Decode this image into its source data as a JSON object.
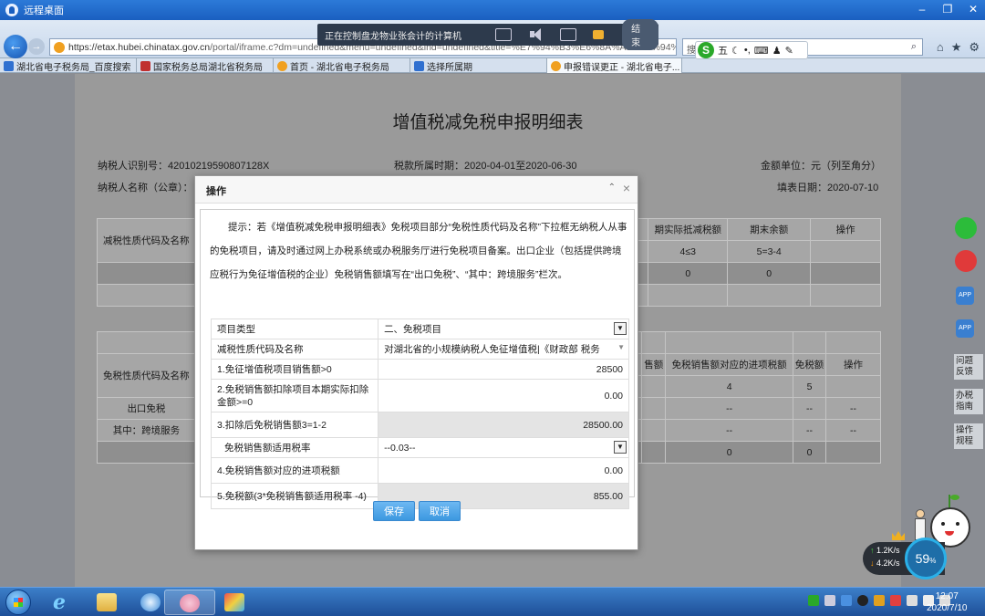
{
  "remote_desktop": {
    "title": "远程桌面",
    "toolbar_status": "正在控制盘龙物业张会计的计算机",
    "end_button": "结束"
  },
  "browser": {
    "url_host": "https://etax.hubei.chinatax.gov.cn",
    "url_path": "/portal/iframe.c?dm=undefined&menu=undefined&ind=undefined&title=%E7%94%B3%E6%8A%A5%E9%94%99%E8%AF%AF%E6%9B%B4%E6%AD%A3",
    "search_placeholder": "搜",
    "ime_label": "五",
    "tabs": [
      {
        "label": "湖北省电子税务局_百度搜索",
        "icon_color": "#3070d0"
      },
      {
        "label": "国家税务总局湖北省税务局",
        "icon_color": "#c03030"
      },
      {
        "label": "首页 - 湖北省电子税务局",
        "icon_color": "#f0a020"
      },
      {
        "label": "选择所属期",
        "icon_color": "#3070d0"
      },
      {
        "label": "申报错误更正 - 湖北省电子...",
        "icon_color": "#f0a020",
        "active": true
      }
    ]
  },
  "page": {
    "title": "增值税减免税申报明细表",
    "taxpayer_id_label": "纳税人识别号：",
    "taxpayer_id": "42010219590807128X",
    "period_label": "税款所属时期：",
    "period": "2020-04-01至2020-06-30",
    "amount_unit": "金额单位：元（列至角分）",
    "taxpayer_name_label": "纳税人名称（公章）：",
    "fill_date_label": "填表日期：",
    "fill_date": "2020-07-10",
    "reduce_section": {
      "code_header": "减税性质代码及名称",
      "col_actual": "期实际抵减税额",
      "col_end": "期末余额",
      "col_op": "操作",
      "formula_actual": "4≤3",
      "formula_end": "5=3-4",
      "total_actual": "0",
      "total_end": "0"
    },
    "exempt_section": {
      "code_header": "免税性质代码及名称",
      "col_sales": "售额",
      "col_input": "免税销售额对应的进项税额",
      "col_tax": "免税额",
      "col_op": "操作",
      "num_input": "4",
      "num_tax": "5",
      "row_export": "出口免税",
      "row_crossborder": "其中：跨境服务",
      "dash": "--",
      "total_input": "0",
      "total_tax": "0"
    }
  },
  "side_panel": {
    "item1": "问题反馈",
    "item2": "办税指南",
    "item3": "操作规程",
    "app_label": "APP"
  },
  "modal": {
    "title": "操作",
    "hint": "提示：若《增值税减免税申报明细表》免税项目部分“免税性质代码及名称”下拉框无纳税人从事的免税项目，请及时通过网上办税系统或办税服务厅进行免税项目备案。出口企业（包括提供跨境应税行为免征增值税的企业）免税销售额填写在“出口免税”、“其中：跨境服务”栏次。",
    "rows": [
      {
        "label": "项目类型",
        "value": "二、免税项目"
      },
      {
        "label": "减税性质代码及名称",
        "value": "对湖北省的小规模纳税人免征增值税|《财政部 税务"
      },
      {
        "label": "1.免征增值税项目销售额>0",
        "value": "28500"
      },
      {
        "label": "2.免税销售额扣除项目本期实际扣除金额>=0",
        "value": "0.00"
      },
      {
        "label": "3.扣除后免税销售额3=1-2",
        "value": "28500.00"
      },
      {
        "label": "免税销售额适用税率",
        "value": "--0.03--"
      },
      {
        "label": "4.免税销售额对应的进项税额",
        "value": "0.00"
      },
      {
        "label": "5.免税额(3*免税销售额适用税率 -4)",
        "value": "855.00"
      }
    ],
    "save_button": "保存",
    "cancel_button": "取消"
  },
  "widgets": {
    "upload_speed": "1.2K/s",
    "download_speed": "4.2K/s",
    "percent": "59",
    "percent_unit": "%"
  },
  "taskbar": {
    "time": "12:07",
    "date": "2020/7/10"
  }
}
